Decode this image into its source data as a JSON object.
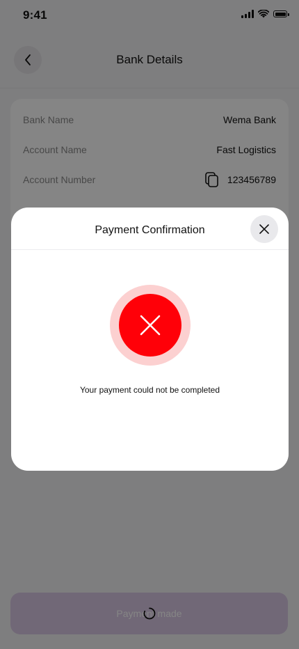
{
  "status_bar": {
    "time": "9:41",
    "icons": [
      "cellular-signal-icon",
      "wifi-icon",
      "battery-icon"
    ]
  },
  "header": {
    "title": "Bank Details",
    "back_icon": "chevron-left-icon"
  },
  "bank_details": {
    "rows": [
      {
        "label": "Bank Name",
        "value": "Wema Bank"
      },
      {
        "label": "Account Name",
        "value": "Fast Logistics"
      },
      {
        "label": "Account Number",
        "value": "123456789",
        "icon": "copy-icon"
      }
    ]
  },
  "footer": {
    "button_label": "Payment made",
    "loading": true,
    "spinner_icon": "loading-spinner-icon"
  },
  "modal": {
    "title": "Payment Confirmation",
    "close_icon": "close-icon",
    "status_icon": "error-x-icon",
    "message": "Your payment could not be completed"
  },
  "colors": {
    "error_red": "#ff0008",
    "error_halo": "#fcd0d0",
    "button_bg": "#d8c8e4",
    "overlay": "rgba(0,0,0,0.48)"
  }
}
